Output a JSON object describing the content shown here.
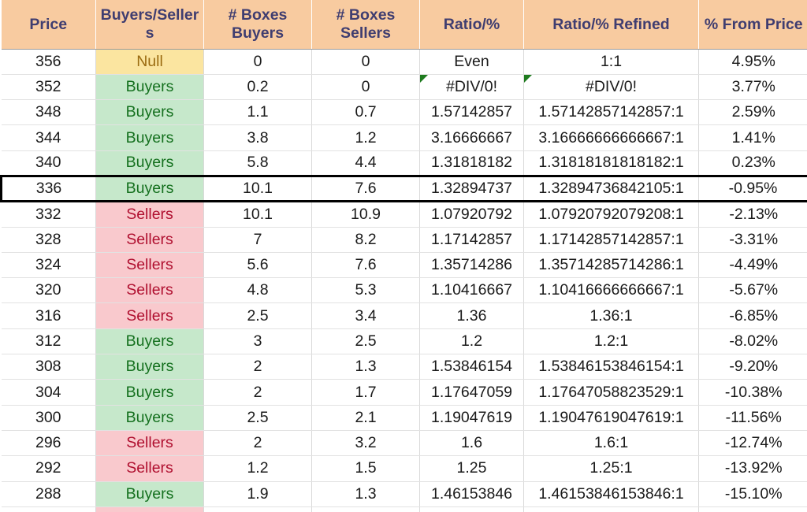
{
  "table": {
    "columns": [
      {
        "key": "price",
        "label": "Price"
      },
      {
        "key": "bs",
        "label": "Buyers/Sellers"
      },
      {
        "key": "boxes_b",
        "label": "# Boxes Buyers"
      },
      {
        "key": "boxes_s",
        "label": "# Boxes Sellers"
      },
      {
        "key": "ratio",
        "label": "Ratio/%"
      },
      {
        "key": "refined",
        "label": "Ratio/% Refined"
      },
      {
        "key": "pct",
        "label": "% From Price"
      }
    ],
    "colors": {
      "header_bg": "#F8CBA0",
      "header_text": "#3F3D70",
      "buyers_bg": "#C6E8CB",
      "buyers_text": "#14701E",
      "sellers_bg": "#F9C9CD",
      "sellers_text": "#B01030",
      "null_bg": "#FBE5A0",
      "null_text": "#9A6B10",
      "error_marker": "#1E7B1E",
      "highlight_border": "#000000"
    },
    "rows": [
      {
        "price": "356",
        "bs": "Null",
        "bs_fill": "null",
        "boxes_b": "0",
        "boxes_s": "0",
        "ratio": "Even",
        "refined": "1:1",
        "pct": "4.95%",
        "error": false,
        "highlight": false
      },
      {
        "price": "352",
        "bs": "Buyers",
        "bs_fill": "buyers",
        "boxes_b": "0.2",
        "boxes_s": "0",
        "ratio": "#DIV/0!",
        "refined": "#DIV/0!",
        "pct": "3.77%",
        "error": true,
        "highlight": false
      },
      {
        "price": "348",
        "bs": "Buyers",
        "bs_fill": "buyers",
        "boxes_b": "1.1",
        "boxes_s": "0.7",
        "ratio": "1.57142857",
        "refined": "1.57142857142857:1",
        "pct": "2.59%",
        "error": false,
        "highlight": false
      },
      {
        "price": "344",
        "bs": "Buyers",
        "bs_fill": "buyers",
        "boxes_b": "3.8",
        "boxes_s": "1.2",
        "ratio": "3.16666667",
        "refined": "3.16666666666667:1",
        "pct": "1.41%",
        "error": false,
        "highlight": false
      },
      {
        "price": "340",
        "bs": "Buyers",
        "bs_fill": "buyers",
        "boxes_b": "5.8",
        "boxes_s": "4.4",
        "ratio": "1.31818182",
        "refined": "1.31818181818182:1",
        "pct": "0.23%",
        "error": false,
        "highlight": false
      },
      {
        "price": "336",
        "bs": "Buyers",
        "bs_fill": "buyers",
        "boxes_b": "10.1",
        "boxes_s": "7.6",
        "ratio": "1.32894737",
        "refined": "1.32894736842105:1",
        "pct": "-0.95%",
        "error": false,
        "highlight": true
      },
      {
        "price": "332",
        "bs": "Sellers",
        "bs_fill": "sellers",
        "boxes_b": "10.1",
        "boxes_s": "10.9",
        "ratio": "1.07920792",
        "refined": "1.07920792079208:1",
        "pct": "-2.13%",
        "error": false,
        "highlight": false
      },
      {
        "price": "328",
        "bs": "Sellers",
        "bs_fill": "sellers",
        "boxes_b": "7",
        "boxes_s": "8.2",
        "ratio": "1.17142857",
        "refined": "1.17142857142857:1",
        "pct": "-3.31%",
        "error": false,
        "highlight": false
      },
      {
        "price": "324",
        "bs": "Sellers",
        "bs_fill": "sellers",
        "boxes_b": "5.6",
        "boxes_s": "7.6",
        "ratio": "1.35714286",
        "refined": "1.35714285714286:1",
        "pct": "-4.49%",
        "error": false,
        "highlight": false
      },
      {
        "price": "320",
        "bs": "Sellers",
        "bs_fill": "sellers",
        "boxes_b": "4.8",
        "boxes_s": "5.3",
        "ratio": "1.10416667",
        "refined": "1.10416666666667:1",
        "pct": "-5.67%",
        "error": false,
        "highlight": false
      },
      {
        "price": "316",
        "bs": "Sellers",
        "bs_fill": "sellers",
        "boxes_b": "2.5",
        "boxes_s": "3.4",
        "ratio": "1.36",
        "refined": "1.36:1",
        "pct": "-6.85%",
        "error": false,
        "highlight": false
      },
      {
        "price": "312",
        "bs": "Buyers",
        "bs_fill": "buyers",
        "boxes_b": "3",
        "boxes_s": "2.5",
        "ratio": "1.2",
        "refined": "1.2:1",
        "pct": "-8.02%",
        "error": false,
        "highlight": false
      },
      {
        "price": "308",
        "bs": "Buyers",
        "bs_fill": "buyers",
        "boxes_b": "2",
        "boxes_s": "1.3",
        "ratio": "1.53846154",
        "refined": "1.53846153846154:1",
        "pct": "-9.20%",
        "error": false,
        "highlight": false
      },
      {
        "price": "304",
        "bs": "Buyers",
        "bs_fill": "buyers",
        "boxes_b": "2",
        "boxes_s": "1.7",
        "ratio": "1.17647059",
        "refined": "1.17647058823529:1",
        "pct": "-10.38%",
        "error": false,
        "highlight": false
      },
      {
        "price": "300",
        "bs": "Buyers",
        "bs_fill": "buyers",
        "boxes_b": "2.5",
        "boxes_s": "2.1",
        "ratio": "1.19047619",
        "refined": "1.19047619047619:1",
        "pct": "-11.56%",
        "error": false,
        "highlight": false
      },
      {
        "price": "296",
        "bs": "Sellers",
        "bs_fill": "sellers",
        "boxes_b": "2",
        "boxes_s": "3.2",
        "ratio": "1.6",
        "refined": "1.6:1",
        "pct": "-12.74%",
        "error": false,
        "highlight": false
      },
      {
        "price": "292",
        "bs": "Sellers",
        "bs_fill": "sellers",
        "boxes_b": "1.2",
        "boxes_s": "1.5",
        "ratio": "1.25",
        "refined": "1.25:1",
        "pct": "-13.92%",
        "error": false,
        "highlight": false
      },
      {
        "price": "288",
        "bs": "Buyers",
        "bs_fill": "buyers",
        "boxes_b": "1.9",
        "boxes_s": "1.3",
        "ratio": "1.46153846",
        "refined": "1.46153846153846:1",
        "pct": "-15.10%",
        "error": false,
        "highlight": false
      },
      {
        "price": "",
        "bs": "",
        "bs_fill": "sellers",
        "boxes_b": "",
        "boxes_s": "",
        "ratio": "",
        "refined": "",
        "pct": "",
        "error": false,
        "highlight": false,
        "clipped": true
      }
    ]
  }
}
